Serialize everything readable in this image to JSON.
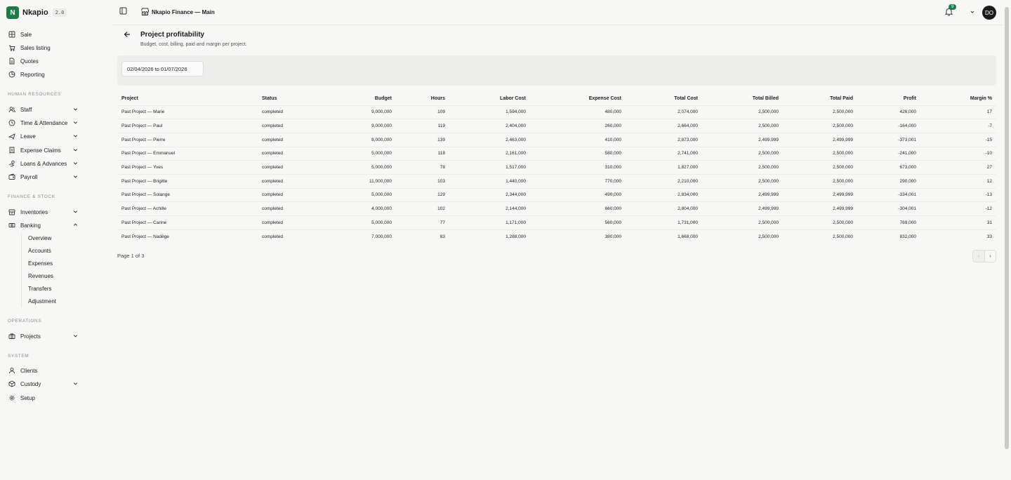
{
  "brand": {
    "logo_letter": "N",
    "name": "Nkapio",
    "version": "2.0"
  },
  "sidebar": {
    "top_items": [
      {
        "label": "Sale",
        "icon": "grid-icon"
      },
      {
        "label": "Sales listing",
        "icon": "cart-icon"
      },
      {
        "label": "Quotes",
        "icon": "document-icon"
      },
      {
        "label": "Reporting",
        "icon": "pie-chart-icon"
      }
    ],
    "sections": {
      "hr": "HUMAN RESOURCES",
      "finance": "FINANCE & STOCK",
      "operations": "OPERATIONS",
      "system": "SYSTEM"
    },
    "hr_items": [
      "Staff",
      "Time & Attendance",
      "Leave",
      "Expense Claims",
      "Loans & Advances",
      "Payroll"
    ],
    "finance_items": [
      "Inventories",
      "Banking"
    ],
    "banking_subitems": [
      "Overview",
      "Accounts",
      "Expenses",
      "Revenues",
      "Transfers",
      "Adjustment"
    ],
    "operations_items": [
      "Projects"
    ],
    "system_items": [
      "Clients",
      "Custody",
      "Setup"
    ]
  },
  "topbar": {
    "workspace": "Nkapio Finance — Main",
    "notification_count": "9",
    "avatar_initials": "DO"
  },
  "page": {
    "title": "Project profitability",
    "subtitle": "Budget, cost, billing, paid and margin per project.",
    "date_range": "02/04/2026 to 01/07/2026",
    "page_info": "Page 1 of 3"
  },
  "table": {
    "headers": [
      "Project",
      "Status",
      "Budget",
      "Hours",
      "Labor Cost",
      "Expense Cost",
      "Total Cost",
      "Total Billed",
      "Total Paid",
      "Profit",
      "Margin %"
    ],
    "rows": [
      [
        "Past Project — Marie",
        "completed",
        "9,000,000",
        "109",
        "1,594,000",
        "480,000",
        "2,074,000",
        "2,500,000",
        "2,500,000",
        "426,000",
        "17"
      ],
      [
        "Past Project — Paul",
        "completed",
        "9,000,000",
        "119",
        "2,404,000",
        "260,000",
        "2,664,000",
        "2,500,000",
        "2,500,000",
        "-164,000",
        "-7"
      ],
      [
        "Past Project — Pierre",
        "completed",
        "8,000,000",
        "139",
        "2,463,000",
        "410,000",
        "2,873,000",
        "2,499,999",
        "2,499,999",
        "-373,001",
        "-15"
      ],
      [
        "Past Project — Emmanuel",
        "completed",
        "5,000,000",
        "118",
        "2,161,000",
        "580,000",
        "2,741,000",
        "2,500,000",
        "2,500,000",
        "-241,000",
        "-10"
      ],
      [
        "Past Project — Yves",
        "completed",
        "5,000,000",
        "78",
        "1,517,000",
        "310,000",
        "1,827,000",
        "2,500,000",
        "2,500,000",
        "673,000",
        "27"
      ],
      [
        "Past Project — Brigitte",
        "completed",
        "11,000,000",
        "103",
        "1,440,000",
        "770,000",
        "2,210,000",
        "2,500,000",
        "2,500,000",
        "290,000",
        "12"
      ],
      [
        "Past Project — Solange",
        "completed",
        "5,000,000",
        "129",
        "2,344,000",
        "490,000",
        "2,834,000",
        "2,499,999",
        "2,499,999",
        "-334,001",
        "-13"
      ],
      [
        "Past Project — Achille",
        "completed",
        "4,000,000",
        "102",
        "2,144,000",
        "660,000",
        "2,804,000",
        "2,499,999",
        "2,499,999",
        "-304,001",
        "-12"
      ],
      [
        "Past Project — Carine",
        "completed",
        "5,000,000",
        "77",
        "1,171,000",
        "560,000",
        "1,731,000",
        "2,500,000",
        "2,500,000",
        "769,000",
        "31"
      ],
      [
        "Past Project — Nadège",
        "completed",
        "7,000,000",
        "83",
        "1,288,000",
        "380,000",
        "1,668,000",
        "2,500,000",
        "2,500,000",
        "832,000",
        "33"
      ]
    ]
  },
  "pager": {
    "prev": "‹",
    "next": "›"
  },
  "colors": {
    "accent": "#1f7a4a",
    "background": "#f7f7f6",
    "filter_bar": "#ededeb"
  }
}
